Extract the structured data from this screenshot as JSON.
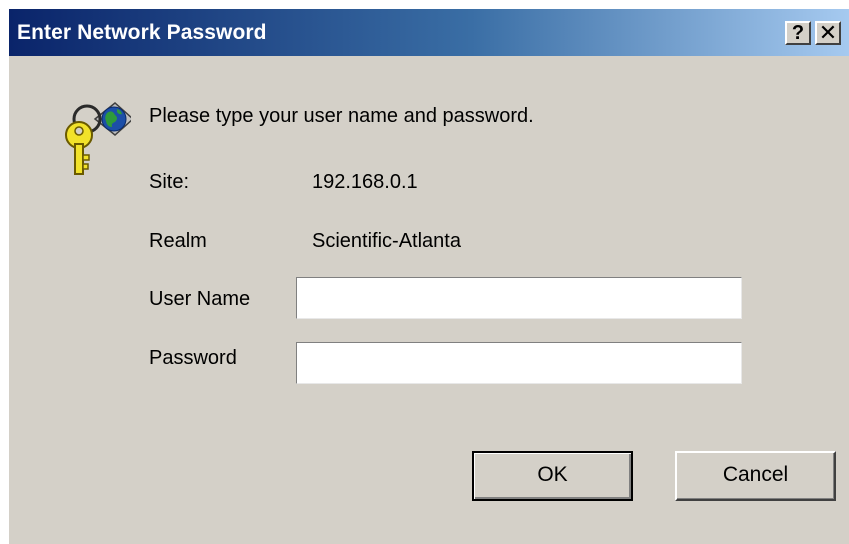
{
  "window": {
    "title": "Enter Network Password",
    "help_glyph": "?",
    "close_glyph": "✕",
    "help_button_icon": "question-mark-icon",
    "close_button_icon": "close-icon",
    "dialog_icon": "keys-with-globe-icon"
  },
  "main": {
    "prompt": "Please type your user name and password.",
    "site_label": "Site:",
    "site_value": "192.168.0.1",
    "realm_label": "Realm",
    "realm_value": "Scientific-Atlanta",
    "username_label": "User Name",
    "username_value": "",
    "password_label": "Password",
    "password_value": ""
  },
  "buttons": {
    "ok_label": "OK",
    "cancel_label": "Cancel"
  },
  "colors": {
    "dialog_face": "#d4d0c8",
    "titlebar_start": "#0a246a",
    "titlebar_end": "#a6caf0",
    "title_text": "#ffffff"
  }
}
